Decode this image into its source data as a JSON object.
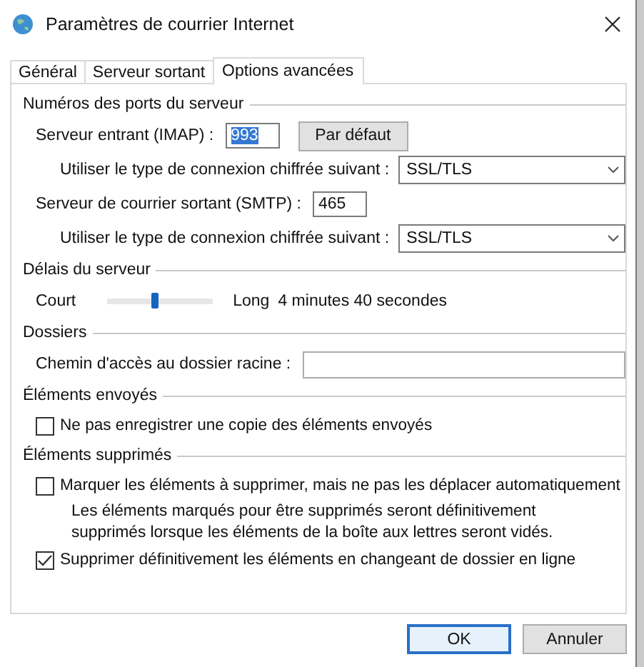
{
  "window": {
    "title": "Paramètres de courrier Internet"
  },
  "tabs": [
    {
      "label": "Général",
      "selected": false
    },
    {
      "label": "Serveur sortant",
      "selected": false
    },
    {
      "label": "Options avancées",
      "selected": true
    }
  ],
  "sections": [
    {
      "title": "Numéros des ports du serveur",
      "rows": [
        {
          "kind": "port",
          "label": "Serveur entrant (IMAP) :",
          "value": "993",
          "highlighted": true,
          "button": "Par défaut"
        },
        {
          "kind": "select",
          "label": "Utiliser le type de connexion chiffrée suivant :",
          "value": "SSL/TLS"
        },
        {
          "kind": "port",
          "label": "Serveur de courrier sortant (SMTP) :",
          "value": "465",
          "highlighted": false
        },
        {
          "kind": "select",
          "label": "Utiliser le type de connexion chiffrée suivant :",
          "value": "SSL/TLS"
        }
      ]
    },
    {
      "title": "Délais du serveur",
      "rows": [
        {
          "kind": "slider",
          "min_label": "Court",
          "max_label": "Long",
          "level": 0.45,
          "reading": "4 minutes 40 secondes"
        }
      ]
    },
    {
      "title": "Dossiers",
      "rows": [
        {
          "kind": "text",
          "label": "Chemin d'accès au dossier racine :"
        }
      ]
    },
    {
      "title": "Éléments envoyés",
      "rows": [
        {
          "kind": "checkbox",
          "label": "Ne pas enregistrer une copie des éléments envoyés",
          "checked": false
        }
      ]
    },
    {
      "title": "Éléments supprimés",
      "rows": [
        {
          "kind": "checkbox",
          "label": "Marquer les éléments à supprimer, mais ne pas les déplacer automatiquement",
          "checked": false
        },
        {
          "kind": "note",
          "text": "Les éléments marqués pour être supprimés seront définitivement supprimés lorsque les éléments de la boîte aux lettres seront vidés."
        },
        {
          "kind": "checkbox",
          "label": "Supprimer définitivement les éléments en changeant de dossier en ligne",
          "checked": true
        }
      ]
    }
  ],
  "buttons": [
    {
      "label": "OK",
      "default": true
    },
    {
      "label": "Annuler",
      "default": false
    }
  ]
}
